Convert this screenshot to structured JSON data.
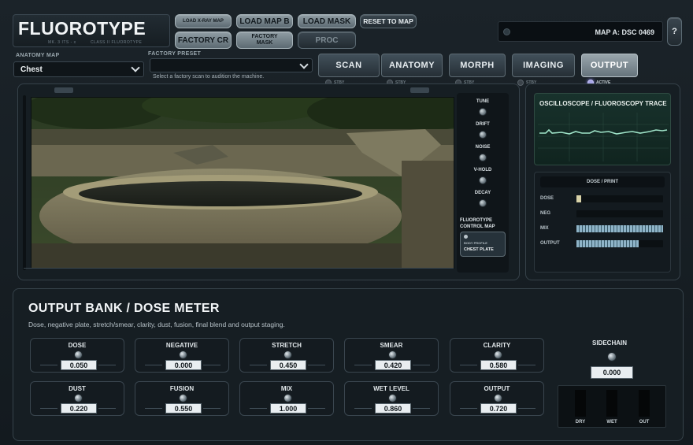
{
  "header": {
    "app_title": "FLUOROTYPE",
    "subtitle_left": "MK. 3 ITS - x",
    "subtitle_right": "CLASS II FLUOROTYPE",
    "buttons": {
      "load_xray_map": "LOAD X-RAY MAP",
      "load_map_b": "LOAD MAP B",
      "load_mask": "LOAD MASK",
      "reset_to_map": "RESET TO MAP",
      "factory_cr": "FACTORY CR",
      "factory_mask": "FACTORY MASK",
      "proc": "PROC"
    },
    "map_readout": "MAP A:  DSC 0469",
    "help": "?"
  },
  "anatomy_map": {
    "label": "ANATOMY MAP",
    "value": "Chest"
  },
  "factory_preset": {
    "label": "FACTORY PRESET",
    "value": "",
    "hint": "Select a factory scan to audition the machine."
  },
  "tabs": [
    {
      "label": "SCAN",
      "status": "STBY",
      "active": false
    },
    {
      "label": "ANATOMY",
      "status": "STBY",
      "active": false
    },
    {
      "label": "MORPH",
      "status": "STBY",
      "active": false
    },
    {
      "label": "IMAGING",
      "status": "STBY",
      "active": false
    },
    {
      "label": "OUTPUT",
      "status": "ACTIVE",
      "active": true
    }
  ],
  "viewer_controls": {
    "knobs": [
      "TUNE",
      "DRIFT",
      "NOISE",
      "V-HOLD",
      "DECAY"
    ],
    "control_map_label_1": "FLUOROTYPE",
    "control_map_label_2": "CONTROL MAP",
    "body_profile_label": "BODY PROFILE",
    "body_profile_value": "CHEST PLATE"
  },
  "scope": {
    "title": "OSCILLOSCOPE / FLUOROSCOPY TRACE"
  },
  "dose_print": {
    "title": "DOSE / PRINT",
    "meters": [
      {
        "label": "DOSE",
        "level": 0.05
      },
      {
        "label": "NEG",
        "level": 0.0
      },
      {
        "label": "MIX",
        "level": 1.0
      },
      {
        "label": "OUTPUT",
        "level": 0.72
      }
    ]
  },
  "bank": {
    "title": "OUTPUT BANK / DOSE METER",
    "description": "Dose, negative plate, stretch/smear, clarity, dust, fusion, final blend and output staging.",
    "params": [
      {
        "label": "DOSE",
        "value": "0.050"
      },
      {
        "label": "NEGATIVE",
        "value": "0.000"
      },
      {
        "label": "STRETCH",
        "value": "0.450"
      },
      {
        "label": "SMEAR",
        "value": "0.420"
      },
      {
        "label": "CLARITY",
        "value": "0.580"
      },
      {
        "label": "DUST",
        "value": "0.220"
      },
      {
        "label": "FUSION",
        "value": "0.550"
      },
      {
        "label": "MIX",
        "value": "1.000"
      },
      {
        "label": "WET LEVEL",
        "value": "0.860"
      },
      {
        "label": "OUTPUT",
        "value": "0.720"
      }
    ],
    "sidechain": {
      "label": "SIDECHAIN",
      "value": "0.000"
    },
    "mix_labels": [
      "DRY",
      "WET",
      "OUT"
    ]
  },
  "colors": {
    "background": "#161e23",
    "accent_active_led": "#a7a6e8",
    "scope_trace": "#9fe3c8",
    "meter_fill": "#8fb4c8"
  }
}
